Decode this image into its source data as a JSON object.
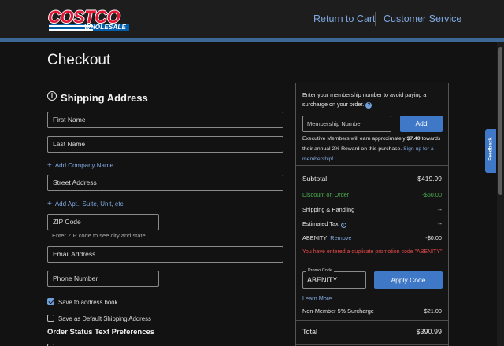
{
  "header": {
    "logo_top": "COSTCO",
    "logo_bottom": "WHOLESALE",
    "return_to_cart": "Return to Cart",
    "customer_service": "Customer Service"
  },
  "page": {
    "title": "Checkout"
  },
  "shipping": {
    "title": "Shipping Address",
    "first_name": "First Name",
    "last_name": "Last Name",
    "add_company": "Add Company Name",
    "street": "Street Address",
    "add_apt": "Add Apt., Suite, Unit, etc.",
    "zip": "ZIP Code",
    "zip_hint": "Enter ZIP code to see city and state",
    "email": "Email Address",
    "phone": "Phone Number",
    "save_address_book": "Save to address book",
    "save_address_book_checked": true,
    "save_default": "Save as Default Shipping Address",
    "save_default_checked": false,
    "order_status_title": "Order Status Text Preferences"
  },
  "summary": {
    "membership_prompt": "Enter your membership number to avoid paying a surcharge on your order.",
    "membership_placeholder": "Membership Number",
    "add_button": "Add",
    "exec_text_1": "Executive Members will earn approximately ",
    "exec_amount": "$7.40",
    "exec_text_2": " towards their annual 2% Reward on this purchase.",
    "signup_link": "Sign up for a membership!",
    "subtotal_label": "Subtotal",
    "subtotal_value": "$419.99",
    "discount_label": "Discount on Order",
    "discount_value": "-$50.00",
    "shipping_label": "Shipping & Handling",
    "shipping_value": "--",
    "tax_label": "Estimated Tax",
    "tax_value": "--",
    "promo_name": "ABENITY",
    "remove_link": "Remove",
    "promo_value": "-$0.00",
    "duplicate_error": "You have entered a duplicate promotion code \"ABENITY\".",
    "promo_code_legend": "Promo Code",
    "promo_code_value": "ABENITY",
    "apply_button": "Apply Code",
    "learn_more": "Learn More",
    "surcharge_label": "Non-Member 5% Surcharge",
    "surcharge_value": "$21.00",
    "total_label": "Total",
    "total_value": "$390.99"
  },
  "feedback": {
    "label": "Feedback"
  },
  "colors": {
    "background": "#121212",
    "header": "#1d1d1d",
    "accent_stripe": "#3d6796",
    "link": "#7fa8e0",
    "button": "#3e78c7",
    "error": "#e34a4a",
    "discount": "#4caf50"
  }
}
